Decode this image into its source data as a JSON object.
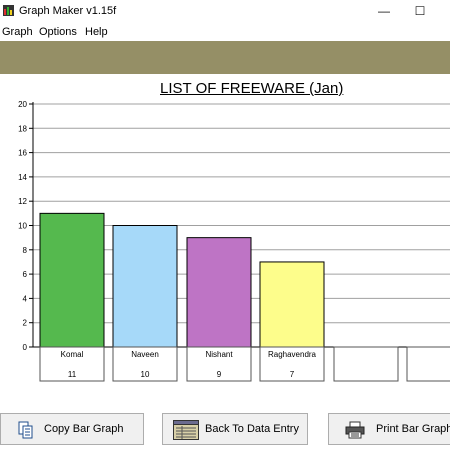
{
  "window": {
    "title": "Graph Maker v1.15f",
    "minimize_glyph": "—",
    "maximize_glyph": "☐"
  },
  "menu": [
    "Graph",
    "Options",
    "Help"
  ],
  "colors": {
    "band": "#958f66"
  },
  "chart_data": {
    "type": "bar",
    "title": "LIST OF FREEWARE (Jan)",
    "categories": [
      "Komal",
      "Naveen",
      "Nishant",
      "Raghavendra",
      "",
      ""
    ],
    "values": [
      11,
      10,
      9,
      7,
      null,
      null
    ],
    "value_labels": [
      "11",
      "10",
      "9",
      "7",
      "",
      ""
    ],
    "colors": [
      "#55b94e",
      "#a6d9f9",
      "#be74c5",
      "#fdfd8b"
    ],
    "ylim": [
      0,
      20
    ],
    "yticks": [
      0,
      2,
      4,
      6,
      8,
      10,
      12,
      14,
      16,
      18,
      20
    ],
    "grid": true,
    "legend": "none"
  },
  "buttons": [
    {
      "label": "Copy Bar Graph",
      "icon": "copy-icon"
    },
    {
      "label": "Back To Data Entry",
      "icon": "data-entry-icon"
    },
    {
      "label": "Print Bar Graph",
      "icon": "printer-icon"
    }
  ]
}
